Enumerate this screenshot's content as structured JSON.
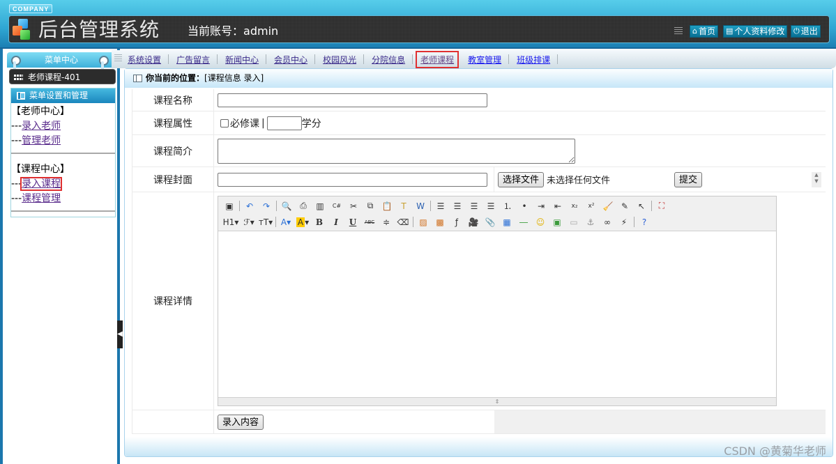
{
  "header": {
    "company": "COMPANY",
    "title": "后台管理系统",
    "account_label": "当前账号：",
    "account_name": "admin",
    "buttons": [
      {
        "icon": "home-icon",
        "glyph": "⌂",
        "label": "首页"
      },
      {
        "icon": "document-icon",
        "glyph": "▤",
        "label": "个人资料修改"
      },
      {
        "icon": "power-icon",
        "glyph": "⏻",
        "label": "退出"
      }
    ]
  },
  "sidebar": {
    "menu_center": "菜单中心",
    "teacher_bar": "老师课程-401",
    "box_title": "菜单设置和管理",
    "groups": [
      {
        "title": "【老师中心】",
        "items": [
          {
            "prefix": "---",
            "label": "录入老师",
            "active": false
          },
          {
            "prefix": "---",
            "label": "管理老师",
            "active": false
          }
        ]
      },
      {
        "title": "【课程中心】",
        "items": [
          {
            "prefix": "---",
            "label": "录入课程",
            "active": true
          },
          {
            "prefix": "---",
            "label": "课程管理",
            "active": false
          }
        ]
      }
    ]
  },
  "nav": {
    "items": [
      {
        "label": "系统设置"
      },
      {
        "label": "广告留言"
      },
      {
        "label": "新闻中心"
      },
      {
        "label": "会员中心"
      },
      {
        "label": "校园风光"
      },
      {
        "label": "分院信息"
      },
      {
        "label": "老师课程",
        "active": true
      },
      {
        "label": "教室管理"
      },
      {
        "label": "班级排课"
      }
    ]
  },
  "location": {
    "label": "你当前的位置：",
    "path": "[课程信息 录入]"
  },
  "form": {
    "course_name": {
      "label": "课程名称",
      "value": ""
    },
    "course_attr": {
      "label": "课程属性",
      "required_label": "必修课",
      "required_checked": false,
      "separator": "|",
      "credit_value": "",
      "credit_unit": "学分"
    },
    "course_intro": {
      "label": "课程简介",
      "value": ""
    },
    "course_cover": {
      "label": "课程封面",
      "value": "",
      "choose_file": "选择文件",
      "no_file": "未选择任何文件",
      "upload": "提交"
    },
    "course_detail": {
      "label": "课程详情",
      "value": ""
    },
    "submit": "录入内容"
  },
  "editor_toolbar": {
    "row1": [
      "source",
      "undo",
      "redo",
      "|",
      "preview",
      "print",
      "template",
      "code",
      "cut",
      "copy",
      "paste",
      "paste-text",
      "paste-word",
      "|",
      "align-left",
      "align-center",
      "align-right",
      "align-justify",
      "ordered-list",
      "unordered-list",
      "indent",
      "outdent",
      "subscript",
      "superscript",
      "clear-format",
      "quick-format",
      "select-all",
      "|",
      "fullscreen"
    ],
    "row2": [
      "heading",
      "font-family",
      "font-size",
      "|",
      "font-color",
      "highlight-color",
      "bold",
      "italic",
      "underline",
      "strikethrough",
      "line-height",
      "remove-format",
      "|",
      "image",
      "multi-image",
      "flash",
      "media",
      "attachment",
      "table",
      "horizontal-rule",
      "emoticon",
      "map",
      "page-break",
      "anchor",
      "link",
      "unlink",
      "|",
      "help"
    ]
  },
  "watermark": "CSDN @黄菊华老师"
}
